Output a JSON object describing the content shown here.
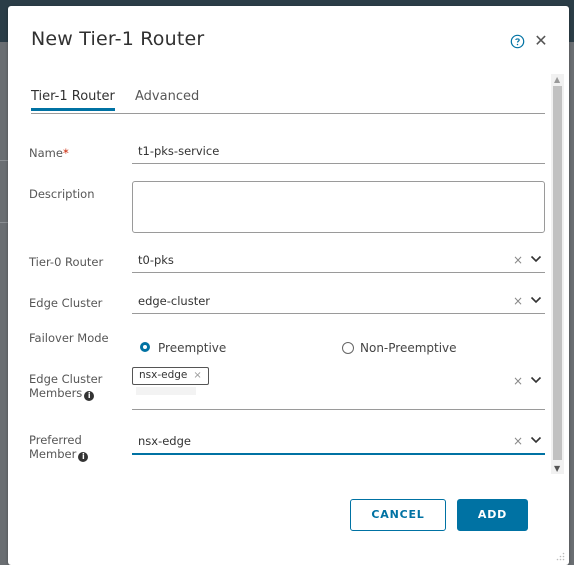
{
  "dialog": {
    "title": "New Tier-1 Router",
    "tabs": [
      {
        "label": "Tier-1 Router",
        "active": true
      },
      {
        "label": "Advanced",
        "active": false
      }
    ]
  },
  "form": {
    "name": {
      "label": "Name",
      "required_mark": "*",
      "value": "t1-pks-service"
    },
    "description": {
      "label": "Description",
      "value": ""
    },
    "tier0_router": {
      "label": "Tier-0 Router",
      "value": "t0-pks",
      "clear": "×"
    },
    "edge_cluster": {
      "label": "Edge Cluster",
      "value": "edge-cluster",
      "clear": "×"
    },
    "failover_mode": {
      "label": "Failover Mode",
      "options": [
        {
          "label": "Preemptive",
          "selected": true
        },
        {
          "label": "Non-Preemptive",
          "selected": false
        }
      ]
    },
    "edge_cluster_members": {
      "label_line1": "Edge Cluster",
      "label_line2": "Members",
      "chips": [
        {
          "label": "nsx-edge",
          "remove": "×"
        }
      ],
      "clear": "×"
    },
    "preferred_member": {
      "label_line1": "Preferred",
      "label_line2": "Member",
      "value": "nsx-edge",
      "clear": "×"
    }
  },
  "actions": {
    "cancel": "CANCEL",
    "add": "ADD"
  },
  "icons": {
    "help": "help-circle-icon",
    "close": "close-icon",
    "info": "info-icon",
    "caret": "chevron-down-icon"
  },
  "colors": {
    "accent": "#0072a3",
    "required": "#c92100"
  }
}
